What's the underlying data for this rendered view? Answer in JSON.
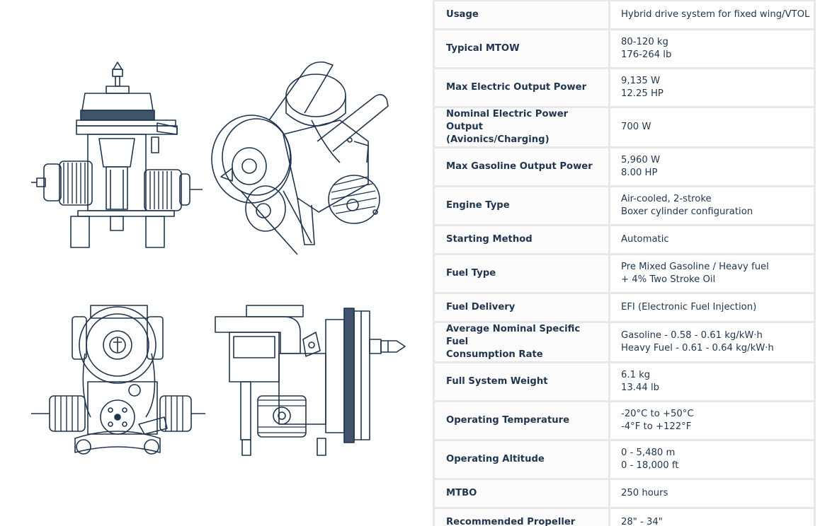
{
  "drawings": [
    {
      "id": "front-view",
      "icon": "engine-front-view-icon"
    },
    {
      "id": "iso-view",
      "icon": "engine-isometric-view-icon"
    },
    {
      "id": "rear-view",
      "icon": "engine-rear-view-icon"
    },
    {
      "id": "side-view",
      "icon": "engine-side-view-icon"
    }
  ],
  "colors": {
    "line_art": "#1f3550",
    "table_border": "#e8e8e8",
    "text": "#1f3550"
  },
  "specs": [
    {
      "label": [
        "Usage"
      ],
      "value": [
        "Hybrid drive system for fixed wing/VTOL"
      ]
    },
    {
      "label": [
        "Typical MTOW"
      ],
      "value": [
        "80-120 kg",
        "176-264 lb"
      ]
    },
    {
      "label": [
        "Max Electric Output Power"
      ],
      "value": [
        "9,135 W",
        "12.25 HP"
      ]
    },
    {
      "label": [
        "Nominal Electric Power Output",
        "(Avionics/Charging)"
      ],
      "value": [
        "700 W"
      ]
    },
    {
      "label": [
        "Max Gasoline Output Power"
      ],
      "value": [
        "5,960 W",
        "8.00 HP"
      ]
    },
    {
      "label": [
        "Engine Type"
      ],
      "value": [
        "Air-cooled, 2-stroke",
        "Boxer cylinder configuration"
      ]
    },
    {
      "label": [
        "Starting Method"
      ],
      "value": [
        "Automatic"
      ]
    },
    {
      "label": [
        "Fuel Type"
      ],
      "value": [
        "Pre Mixed Gasoline / Heavy fuel",
        "+ 4% Two Stroke Oil"
      ]
    },
    {
      "label": [
        "Fuel Delivery"
      ],
      "value": [
        "EFI (Electronic Fuel Injection)"
      ]
    },
    {
      "label": [
        "Average Nominal Specific Fuel",
        "Consumption Rate"
      ],
      "value": [
        "Gasoline - 0.58 - 0.61 kg/kW·h",
        "Heavy Fuel - 0.61 - 0.64 kg/kW·h"
      ]
    },
    {
      "label": [
        "Full System Weight"
      ],
      "value": [
        "6.1 kg",
        "13.44 lb"
      ]
    },
    {
      "label": [
        "Operating Temperature"
      ],
      "value": [
        "-20°C to +50°C",
        "-4°F to +122°F"
      ]
    },
    {
      "label": [
        "Operating Altitude"
      ],
      "value": [
        "0 - 5,480 m",
        "0 - 18,000 ft"
      ]
    },
    {
      "label": [
        "MTBO"
      ],
      "value": [
        "250 hours"
      ]
    },
    {
      "label": [
        "Recommended Propeller"
      ],
      "value": [
        "28\" - 34\""
      ]
    }
  ]
}
